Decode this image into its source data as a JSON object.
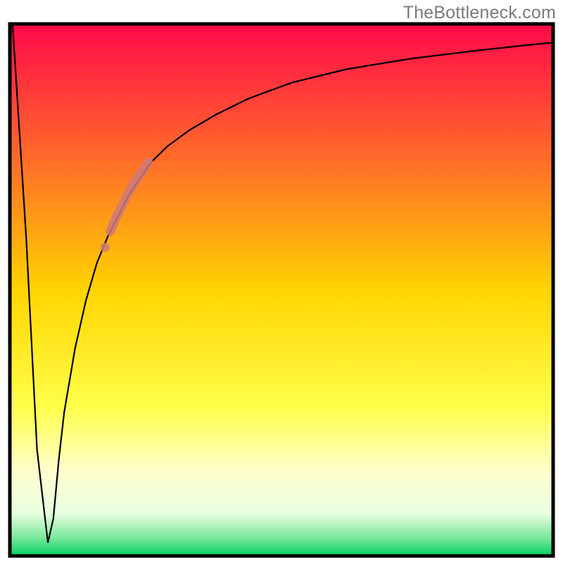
{
  "watermark": {
    "text": "TheBottleneck.com"
  },
  "chart_data": {
    "type": "line",
    "title": "",
    "xlabel": "",
    "ylabel": "",
    "xlim": [
      0,
      100
    ],
    "ylim": [
      0,
      100
    ],
    "grid": false,
    "legend": false,
    "background": {
      "description": "vertical color gradient (top to bottom)",
      "stops": [
        {
          "pos": 0.0,
          "color": "#ff0a4a"
        },
        {
          "pos": 0.25,
          "color": "#ff6a2a"
        },
        {
          "pos": 0.5,
          "color": "#ffd400"
        },
        {
          "pos": 0.72,
          "color": "#ffff4a"
        },
        {
          "pos": 0.84,
          "color": "#ffffcc"
        },
        {
          "pos": 0.92,
          "color": "#e9ffe0"
        },
        {
          "pos": 0.965,
          "color": "#7de89c"
        },
        {
          "pos": 1.0,
          "color": "#00d060"
        }
      ]
    },
    "series": [
      {
        "name": "bottleneck-curve",
        "color": "#000000",
        "x": [
          0.5,
          3,
          5,
          7,
          8,
          9,
          10,
          12,
          14,
          16,
          18,
          20,
          22,
          24,
          26,
          29,
          33,
          38,
          44,
          52,
          62,
          74,
          86,
          95,
          100
        ],
        "values": [
          100,
          60,
          20,
          2.5,
          7,
          18,
          27,
          39,
          48,
          55,
          60,
          64,
          68,
          71,
          74,
          77,
          80,
          83,
          86,
          89,
          91.5,
          93.5,
          95,
          96,
          96.5
        ]
      }
    ],
    "highlight": {
      "description": "thick translucent salmon segment along the rising curve",
      "color": "#cc7a7a",
      "opacity": 0.85,
      "x": [
        17.5,
        18.5,
        19.5,
        20.5,
        21.5,
        22.5,
        23.5,
        24.5,
        25.5
      ],
      "values": [
        58,
        61,
        63.5,
        65.5,
        67.5,
        69.5,
        71,
        72.5,
        74
      ],
      "gap_after_index": 0
    }
  }
}
